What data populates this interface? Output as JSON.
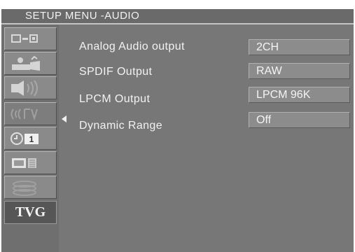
{
  "title": "SETUP MENU -AUDIO",
  "sidebar": {
    "items": [
      {
        "icon": "general-setup-icon"
      },
      {
        "icon": "video-setup-icon"
      },
      {
        "icon": "speaker-setup-icon"
      },
      {
        "icon": "audio-setup-icon",
        "active": true
      },
      {
        "icon": "rating-setup-icon",
        "label": "1"
      },
      {
        "icon": "display-setup-icon"
      },
      {
        "icon": "disc-setup-icon"
      }
    ],
    "tvg_label": "TVG"
  },
  "settings": [
    {
      "label": "Analog Audio output",
      "value": "2CH"
    },
    {
      "label": "SPDIF Output",
      "value": "RAW"
    },
    {
      "label": "LPCM  Output",
      "value": "LPCM 96K"
    },
    {
      "label": "Dynamic Range",
      "value": "Off"
    }
  ],
  "colors": {
    "panel": "#777777",
    "box": "#8c8c8c",
    "text": "#f2f2f2"
  }
}
